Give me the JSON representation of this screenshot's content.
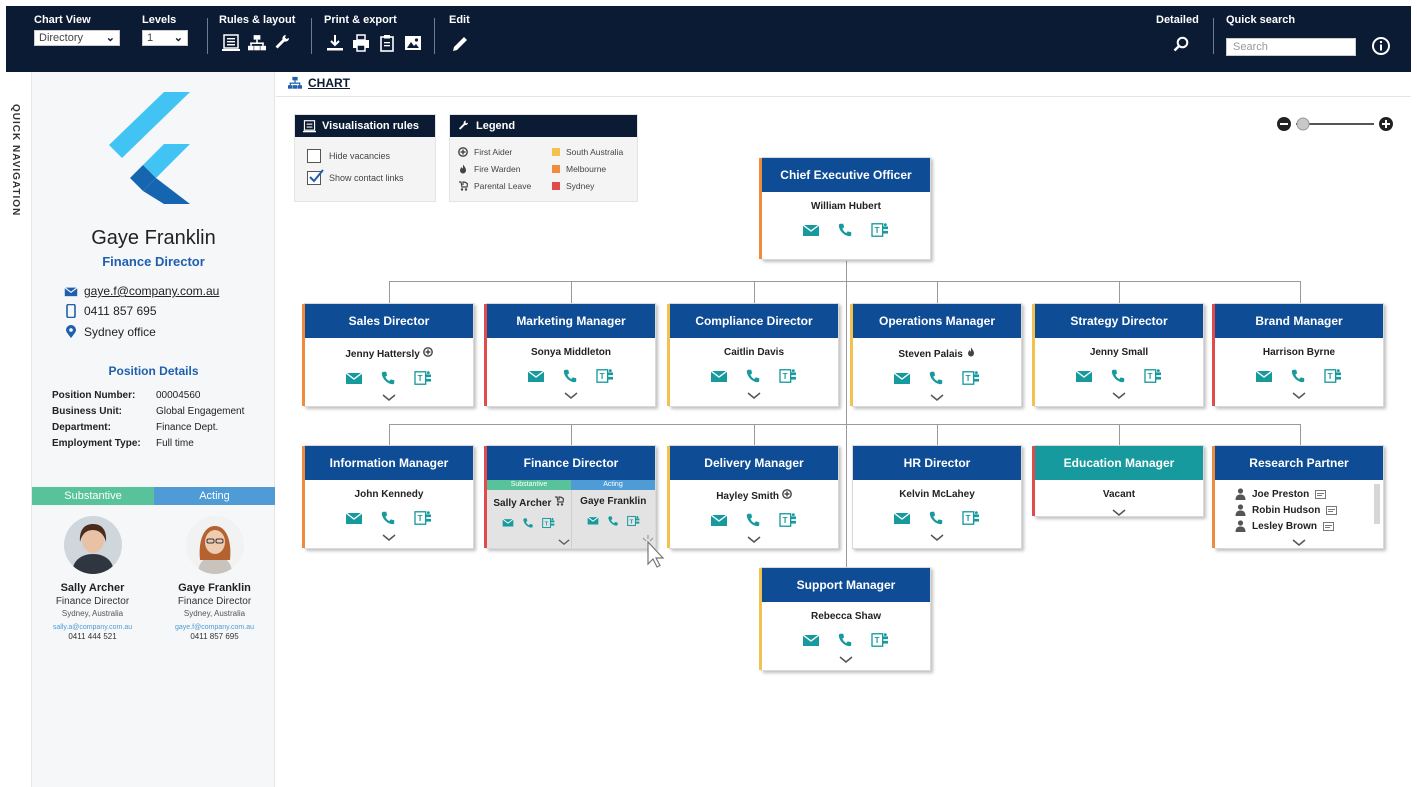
{
  "toolbar": {
    "chart_view_label": "Chart View",
    "chart_view_value": "Directory",
    "levels_label": "Levels",
    "levels_value": "1",
    "rules_label": "Rules & layout",
    "print_label": "Print & export",
    "edit_label": "Edit",
    "detailed_label": "Detailed",
    "quick_search_label": "Quick search",
    "search_placeholder": "Search"
  },
  "quick_nav": {
    "label": "QUICK NAVIGATION"
  },
  "profile": {
    "name": "Gaye Franklin",
    "title": "Finance Director",
    "email": "gaye.f@company.com.au",
    "phone": "0411 857 695",
    "location": "Sydney office",
    "position_details_label": "Position Details",
    "details": [
      {
        "label": "Position Number:",
        "value": "00004560"
      },
      {
        "label": "Business Unit:",
        "value": "Global Engagement"
      },
      {
        "label": "Department:",
        "value": "Finance Dept."
      },
      {
        "label": "Employment Type:",
        "value": "Full time"
      }
    ],
    "tab_substantive": "Substantive",
    "tab_acting": "Acting",
    "people": [
      {
        "name": "Sally Archer",
        "role": "Finance Director",
        "location": "Sydney, Australia",
        "email": "sally.a@company.com.au",
        "phone": "0411 444 521"
      },
      {
        "name": "Gaye Franklin",
        "role": "Finance Director",
        "location": "Sydney, Australia",
        "email": "gaye.f@company.com.au",
        "phone": "0411 857 695"
      }
    ]
  },
  "chart_tab": {
    "label": "CHART"
  },
  "visualisation": {
    "title": "Visualisation rules",
    "options": [
      {
        "label": "Hide vacancies",
        "checked": false
      },
      {
        "label": "Show contact links",
        "checked": true
      }
    ]
  },
  "legend": {
    "title": "Legend",
    "left": [
      "First Aider",
      "Fire Warden",
      "Parental Leave"
    ],
    "right": [
      "South Australia",
      "Melbourne",
      "Sydney"
    ],
    "colors": {
      "South Australia": "#f2c14e",
      "Melbourne": "#f08a3c",
      "Sydney": "#e04b4b"
    }
  },
  "colors": {
    "navy": "#0b1b33",
    "card_head": "#0f4c96",
    "teal_head": "#169a9e",
    "icon_teal": "#169a9e",
    "link_blue": "#1f5fae"
  },
  "cards": {
    "ceo": {
      "title": "Chief Executive Officer",
      "name": "William Hubert"
    },
    "sales": {
      "title": "Sales Director",
      "name": "Jenny Hattersly"
    },
    "marketing": {
      "title": "Marketing Manager",
      "name": "Sonya Middleton"
    },
    "compliance": {
      "title": "Compliance Director",
      "name": "Caitlin Davis"
    },
    "operations": {
      "title": "Operations Manager",
      "name": "Steven Palais"
    },
    "strategy": {
      "title": "Strategy Director",
      "name": "Jenny Small"
    },
    "brand": {
      "title": "Brand Manager",
      "name": "Harrison Byrne"
    },
    "information": {
      "title": "Information Manager",
      "name": "John Kennedy"
    },
    "finance": {
      "title": "Finance Director",
      "sub_label": "Substantive",
      "act_label": "Acting",
      "sub_name": "Sally Archer",
      "act_name": "Gaye Franklin"
    },
    "delivery": {
      "title": "Delivery Manager",
      "name": "Hayley Smith"
    },
    "hr": {
      "title": "HR Director",
      "name": "Kelvin McLahey"
    },
    "education": {
      "title": "Education Manager",
      "name": "Vacant"
    },
    "research": {
      "title": "Research Partner",
      "members": [
        "Joe Preston",
        "Robin Hudson",
        "Lesley Brown"
      ]
    },
    "support": {
      "title": "Support Manager",
      "name": "Rebecca Shaw"
    }
  }
}
